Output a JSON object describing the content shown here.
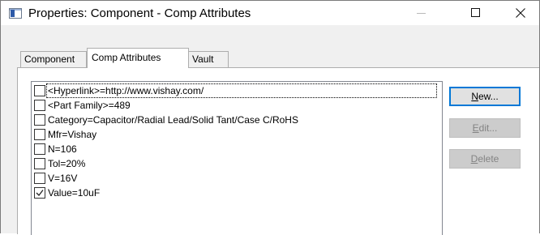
{
  "window": {
    "title": "Properties: Component - Comp Attributes"
  },
  "tabs": [
    {
      "label": "Component",
      "active": false
    },
    {
      "label": "Comp Attributes",
      "active": true
    },
    {
      "label": "Vault",
      "active": false
    }
  ],
  "attributes": [
    {
      "label": "<Hyperlink>=http://www.vishay.com/",
      "checked": false,
      "focused": true
    },
    {
      "label": "<Part Family>=489",
      "checked": false
    },
    {
      "label": "Category=Capacitor/Radial Lead/Solid Tant/Case C/RoHS",
      "checked": false
    },
    {
      "label": "Mfr=Vishay",
      "checked": false
    },
    {
      "label": "N=106",
      "checked": false
    },
    {
      "label": "Tol=20%",
      "checked": false
    },
    {
      "label": "V=16V",
      "checked": false
    },
    {
      "label": "Value=10uF",
      "checked": true
    }
  ],
  "buttons": {
    "new_mnemonic": "N",
    "new_rest": "ew...",
    "edit_mnemonic": "E",
    "edit_rest": "dit...",
    "delete_mnemonic": "D",
    "delete_rest": "elete"
  },
  "icons": {
    "app": "properties-window-icon",
    "minimize": "minimize-icon",
    "maximize": "maximize-icon",
    "close": "close-icon",
    "check": "checkmark-icon"
  },
  "colors": {
    "focus_border": "#0078d7",
    "disabled_text": "#838383"
  }
}
